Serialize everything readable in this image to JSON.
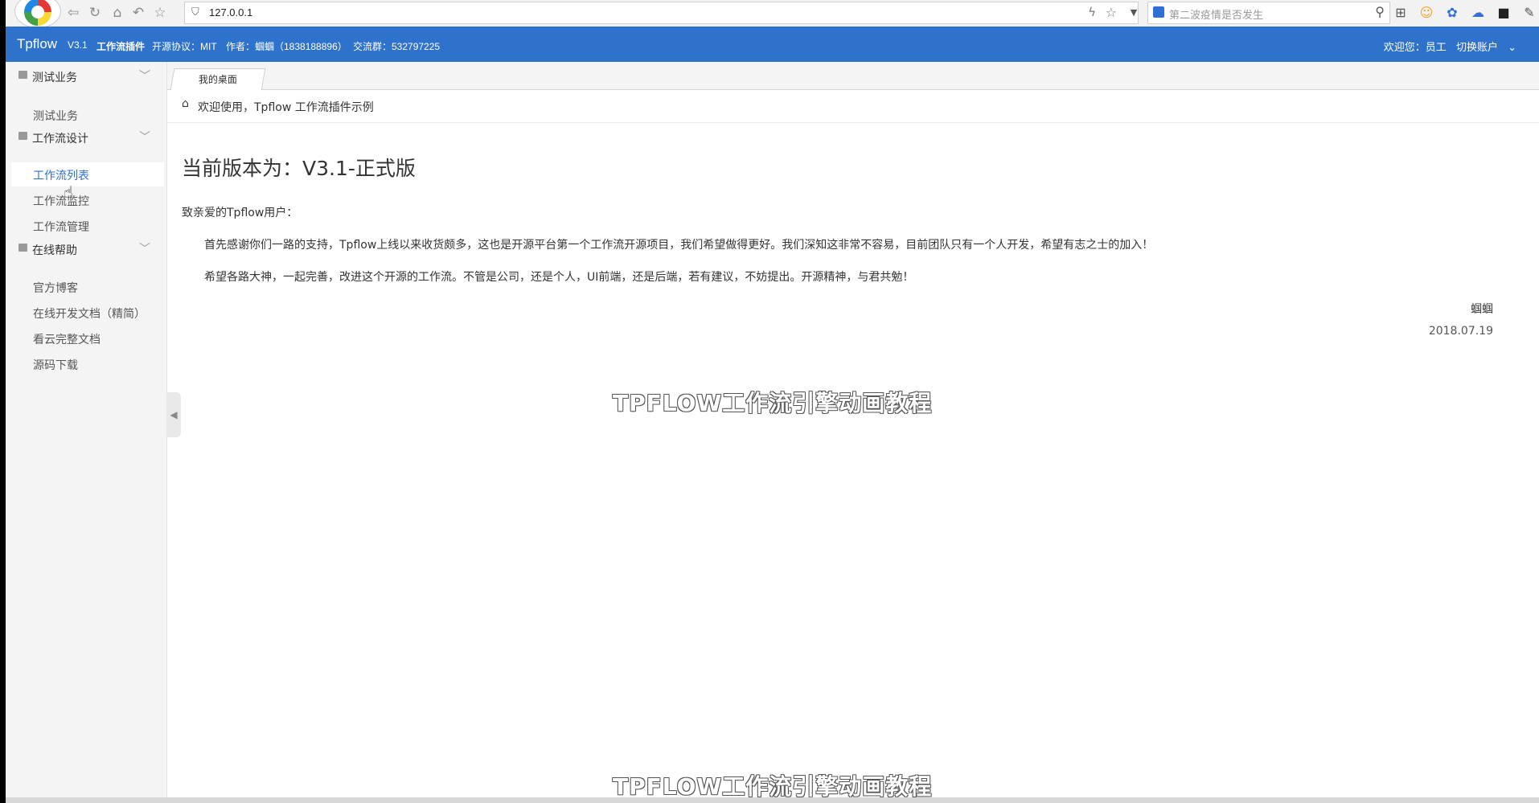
{
  "browser": {
    "url": "127.0.0.1",
    "search_placeholder": "第二波疫情是否发生"
  },
  "header": {
    "brand": "Tpflow",
    "version": "V3.1",
    "plugin": "工作流插件",
    "license": "开源协议：MIT",
    "author": "作者：蝈蝈（1838188896）",
    "group": "交流群：532797225",
    "welcome": "欢迎您：员工",
    "switch_account": "切换账户"
  },
  "sidebar": {
    "groups": [
      {
        "label": "测试业务",
        "items": [
          "测试业务"
        ]
      },
      {
        "label": "工作流设计",
        "items": [
          "工作流列表",
          "工作流监控",
          "工作流管理"
        ]
      },
      {
        "label": "在线帮助",
        "items": [
          "官方博客",
          "在线开发文档（精简）",
          "看云完整文档",
          "源码下载"
        ]
      }
    ],
    "active_item": "工作流列表"
  },
  "tabs": {
    "current": "我的桌面"
  },
  "breadcrumb": "欢迎使用，Tpflow 工作流插件示例",
  "content": {
    "version_title": "当前版本为：V3.1-正式版",
    "greeting": "致亲爱的Tpflow用户：",
    "paragraph1": "首先感谢你们一路的支持，Tpflow上线以来收货颇多，这也是开源平台第一个工作流开源项目，我们希望做得更好。我们深知这非常不容易，目前团队只有一个人开发，希望有志之士的加入！",
    "paragraph2": "希望各路大神，一起完善，改进这个开源的工作流。不管是公司，还是个人，UI前端，还是后端，若有建议，不妨提出。开源精神，与君共勉！",
    "signature": "蝈蝈",
    "date": "2018.07.19"
  },
  "overlay": {
    "subtitle_center": "TPFLOW工作流引擎动画教程",
    "subtitle_bottom": "TPFLOW工作流引擎动画教程"
  },
  "colors": {
    "header_bg": "#2f72cc",
    "sidebar_bg": "#f4f4f4",
    "active_link": "#2f72cc"
  }
}
